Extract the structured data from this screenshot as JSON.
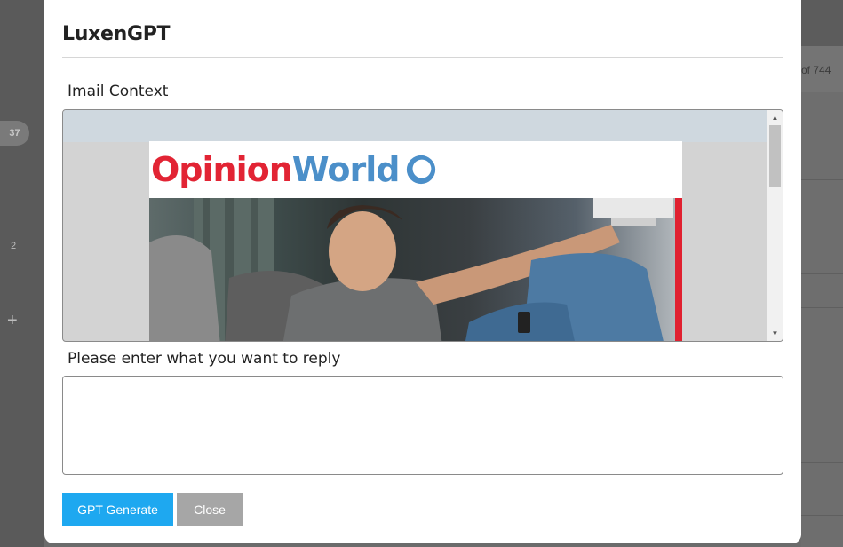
{
  "background": {
    "badge_count": "37",
    "side_number": "2",
    "add_glyph": "+",
    "pagination_text": "of 744"
  },
  "modal": {
    "title": "LuxenGPT",
    "context_label": "Imail Context",
    "reply_label": "Please enter what you want to reply",
    "reply_value": "",
    "email_preview": {
      "brand_part1": "Opinion",
      "brand_part2": "World",
      "brand_colors": {
        "opinion": "#e22434",
        "world": "#4b8fc9"
      }
    },
    "buttons": {
      "generate_label": "GPT Generate",
      "close_label": "Close"
    }
  },
  "colors": {
    "primary_button": "#1ea8f0",
    "secondary_button": "#a6a6a6"
  }
}
